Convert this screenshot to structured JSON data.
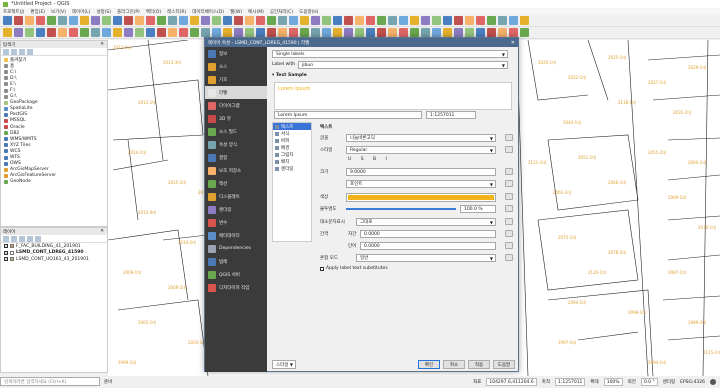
{
  "window": {
    "title": "*Untitled Project - QGIS"
  },
  "menu": [
    "프로젝트(J)",
    "편집(E)",
    "보기(V)",
    "레이어(L)",
    "설정(S)",
    "플러그인(P)",
    "벡터(O)",
    "래스터(R)",
    "데이터베이스(D)",
    "웹(W)",
    "메시(M)",
    "공간처리(C)",
    "도움말(H)"
  ],
  "browser": {
    "title": "탐색기",
    "items": [
      "즐겨찾기",
      "홈",
      "C:\\",
      "D:\\",
      "E:\\",
      "F:\\",
      "G:\\",
      "GeoPackage",
      "SpatiaLite",
      "PostGIS",
      "MSSQL",
      "Oracle",
      "DB2",
      "WMS/WMTS",
      "XYZ Tiles",
      "WCS",
      "WFS",
      "OWS",
      "ArcGisMapServer",
      "ArcGisFeatureServer",
      "GeoNode"
    ]
  },
  "layers": {
    "title": "레이어",
    "items": [
      "F_FAC_BUILDING_41_201901",
      "LSMD_CONT_LDREG_41590",
      "LSMD_CONT_UQ161_43_201901"
    ],
    "colors": [
      "#c9a068",
      "#ffffff",
      "#9bc27d"
    ]
  },
  "search": {
    "placeholder": "검색하려면 입력하세요 (Ctrl+K)"
  },
  "status": {
    "ready": "준비",
    "coord_label": "좌표",
    "coord": "104297.6,411204.6",
    "scale_label": "축척",
    "scale": "1:1257011",
    "mag_label": "확대",
    "mag": "100%",
    "rot_label": "회전",
    "rot": "0.0 °",
    "render": "렌더링",
    "crs": "EPSG:4326"
  },
  "dialog": {
    "title": "레이어 속성 - LSMD_CONT_LDREG_41590 | 라벨",
    "sidebar": [
      "정보",
      "소스",
      "기호",
      "라벨",
      "다이어그램",
      "3D 뷰",
      "소스 필드",
      "속성 양식",
      "결합",
      "보조 저장소",
      "액션",
      "디스플레이",
      "렌더링",
      "변수",
      "메타데이터",
      "Dependencies",
      "범례",
      "QGIS 서버",
      "디지타이저 작업"
    ],
    "active_index": 3,
    "mode": "Single labels",
    "label_with_label": "Label with",
    "label_with_value": "jibun",
    "text_sample_header": "Text Sample",
    "sample_text": "Lorem Ipsum",
    "preview_input": "Lorem Ipsum",
    "preview_scale": "1:1257011",
    "subnav": [
      "텍스트",
      "서식",
      "버퍼",
      "배경",
      "그림자",
      "배치",
      "렌더링"
    ],
    "section_title": "텍스트",
    "font_label": "글꼴",
    "font_value": "나눔바른고딕",
    "style_label": "스타일",
    "style_value": "Regular",
    "size_label": "크기",
    "size_value": "9.0000",
    "unit_value": "포인트",
    "color_label": "색상",
    "text_color": "#f2b21a",
    "opacity_label": "불투명도",
    "opacity_value": "100.0 %",
    "case_label": "대소문자표시",
    "case_value": "그대로",
    "spacing_label": "간격",
    "letter_label": "자간",
    "letter_value": "0.0000",
    "word_label": "단어",
    "word_value": "0.0000",
    "blend_label": "혼합 모드",
    "blend_value": "일반",
    "substitutes_label": "Apply label text substitutes",
    "style_menu": "스타일",
    "buttons": [
      "확인",
      "취소",
      "적용",
      "도움말"
    ]
  },
  "map_labels": [
    "2013-1대",
    "2013-3대",
    "2012-1대",
    "2012-2대",
    "2014-1대",
    "2015-2대",
    "2016-1대",
    "2020-1대",
    "2022-1대",
    "2025-1대",
    "2027-1대",
    "2029-1대",
    "2031-2대",
    "2040-1대",
    "2051-1대",
    "2055-2대",
    "2060-1대",
    "2061-1대",
    "2066-1대",
    "2069-1대",
    "2070-1대",
    "2075-1대",
    "2078-2대",
    "2087-1대",
    "2094-1대",
    "2098-1대",
    "2012-4대",
    "2010-2대",
    "2009-1대",
    "2008-2대",
    "2005-1대",
    "2003-1대",
    "1999-2대",
    "1997-1대",
    "1994-1대",
    "1989-2대",
    "2115-1대",
    "2118-1대",
    "2120-1대",
    "2121-1대"
  ]
}
